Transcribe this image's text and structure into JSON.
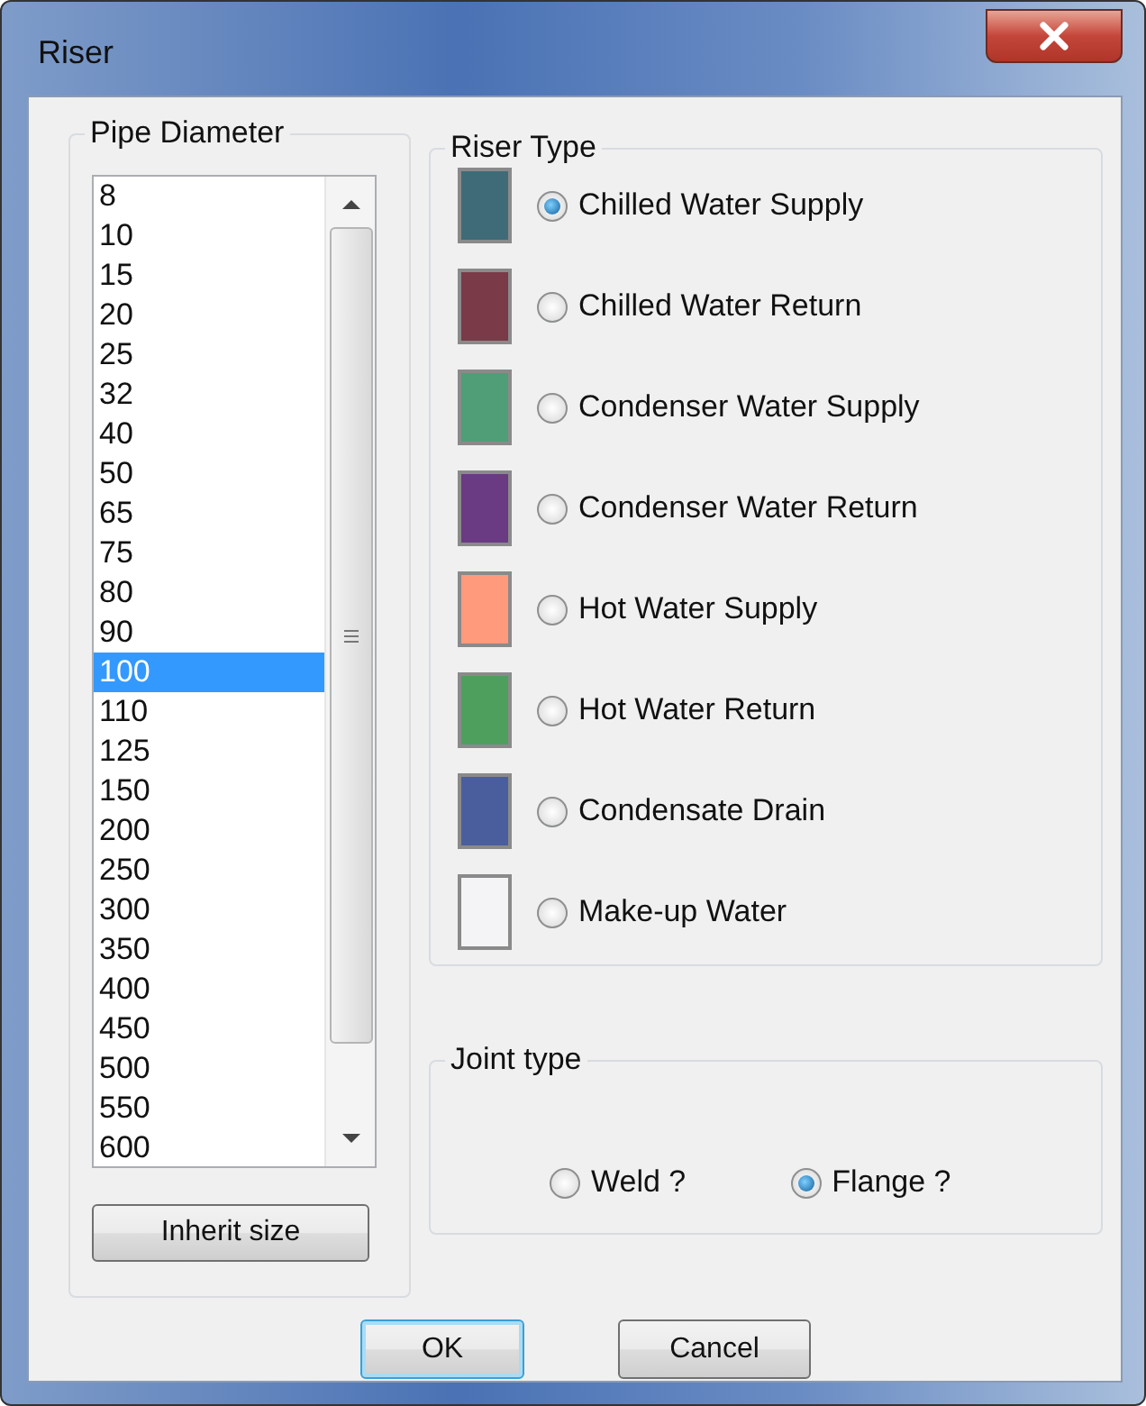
{
  "window": {
    "title": "Riser"
  },
  "pipe_diameter": {
    "title": "Pipe Diameter",
    "items": [
      {
        "label": "8",
        "selected": false
      },
      {
        "label": "10",
        "selected": false
      },
      {
        "label": "15",
        "selected": false
      },
      {
        "label": "20",
        "selected": false
      },
      {
        "label": "25",
        "selected": false
      },
      {
        "label": "32",
        "selected": false
      },
      {
        "label": "40",
        "selected": false
      },
      {
        "label": "50",
        "selected": false
      },
      {
        "label": "65",
        "selected": false
      },
      {
        "label": "75",
        "selected": false
      },
      {
        "label": "80",
        "selected": false
      },
      {
        "label": "90",
        "selected": false
      },
      {
        "label": "100",
        "selected": true
      },
      {
        "label": "110",
        "selected": false
      },
      {
        "label": "125",
        "selected": false
      },
      {
        "label": "150",
        "selected": false
      },
      {
        "label": "200",
        "selected": false
      },
      {
        "label": "250",
        "selected": false
      },
      {
        "label": "300",
        "selected": false
      },
      {
        "label": "350",
        "selected": false
      },
      {
        "label": "400",
        "selected": false
      },
      {
        "label": "450",
        "selected": false
      },
      {
        "label": "500",
        "selected": false
      },
      {
        "label": "550",
        "selected": false
      },
      {
        "label": "600",
        "selected": false
      }
    ],
    "button": "Inherit size"
  },
  "riser_type": {
    "title": "Riser Type",
    "options": [
      {
        "label": "Chilled Water Supply",
        "color": "#3f6b78",
        "selected": true
      },
      {
        "label": "Chilled Water Return",
        "color": "#7a3a48",
        "selected": false
      },
      {
        "label": "Condenser Water Supply",
        "color": "#4f9e78",
        "selected": false
      },
      {
        "label": "Condenser Water Return",
        "color": "#6a3a82",
        "selected": false
      },
      {
        "label": "Hot Water Supply",
        "color": "#ff9a7c",
        "selected": false
      },
      {
        "label": "Hot Water Return",
        "color": "#4e9e5e",
        "selected": false
      },
      {
        "label": "Condensate Drain",
        "color": "#4a5e9e",
        "selected": false
      },
      {
        "label": "Make-up Water",
        "color": "#f4f4f6",
        "selected": false
      }
    ]
  },
  "joint_type": {
    "title": "Joint type",
    "options": [
      {
        "label": "Weld ?",
        "selected": false
      },
      {
        "label": "Flange ?",
        "selected": true
      }
    ]
  },
  "buttons": [
    {
      "label": "OK",
      "default": true
    },
    {
      "label": "Cancel",
      "default": false
    }
  ]
}
